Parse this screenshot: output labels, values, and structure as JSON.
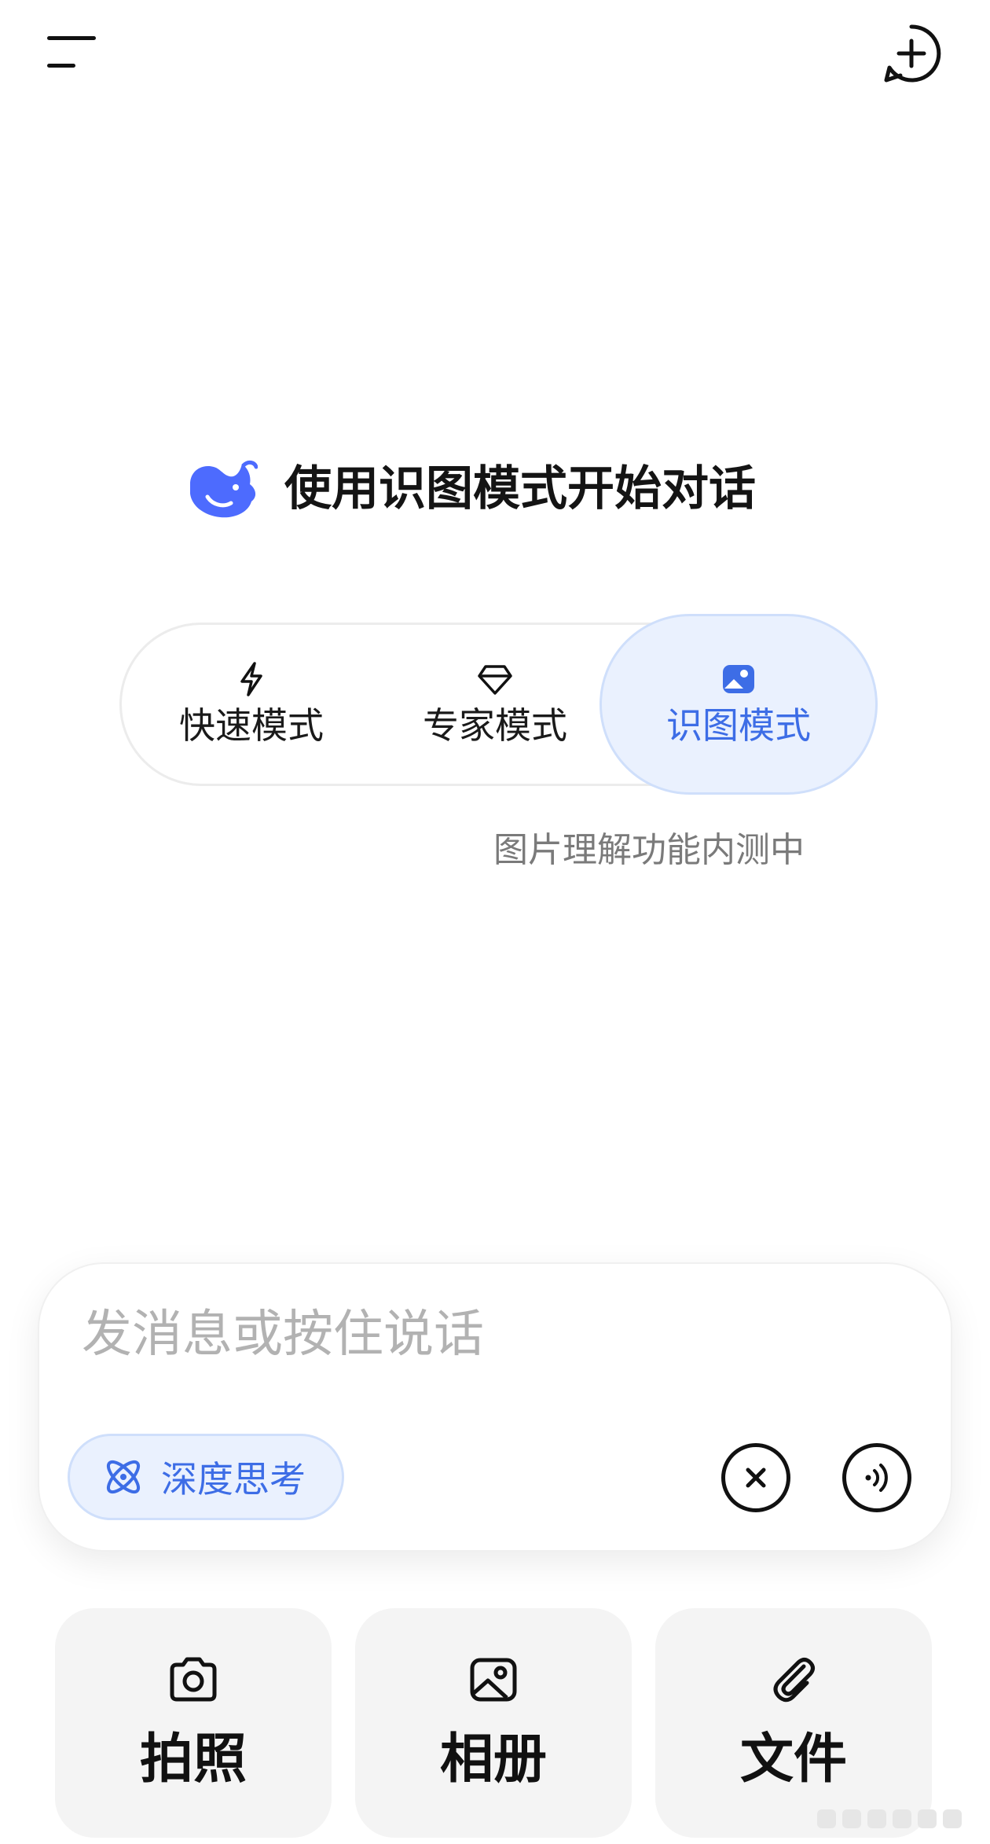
{
  "header": {
    "menu_icon": "menu-icon",
    "new_chat_icon": "new-chat-plus-icon"
  },
  "hero": {
    "logo": "deepseek-whale-logo",
    "title": "使用识图模式开始对话"
  },
  "modes": {
    "selected": "识图模式",
    "items": [
      {
        "label": "快速模式",
        "icon": "lightning-icon"
      },
      {
        "label": "专家模式",
        "icon": "diamond-icon"
      },
      {
        "label": "识图模式",
        "icon": "image-icon"
      }
    ],
    "note": "图片理解功能内测中"
  },
  "composer": {
    "placeholder": "发消息或按住说话",
    "value": "",
    "deep_think_label": "深度思考",
    "deep_think_active": true
  },
  "attachments": {
    "items": [
      {
        "label": "拍照",
        "icon": "camera-icon"
      },
      {
        "label": "相册",
        "icon": "photo-album-icon"
      },
      {
        "label": "文件",
        "icon": "paperclip-icon"
      }
    ]
  },
  "colors": {
    "accent": "#3d6de6",
    "accent_bg": "#eaf1fe",
    "text": "#111111",
    "muted": "#7a7a7a"
  }
}
